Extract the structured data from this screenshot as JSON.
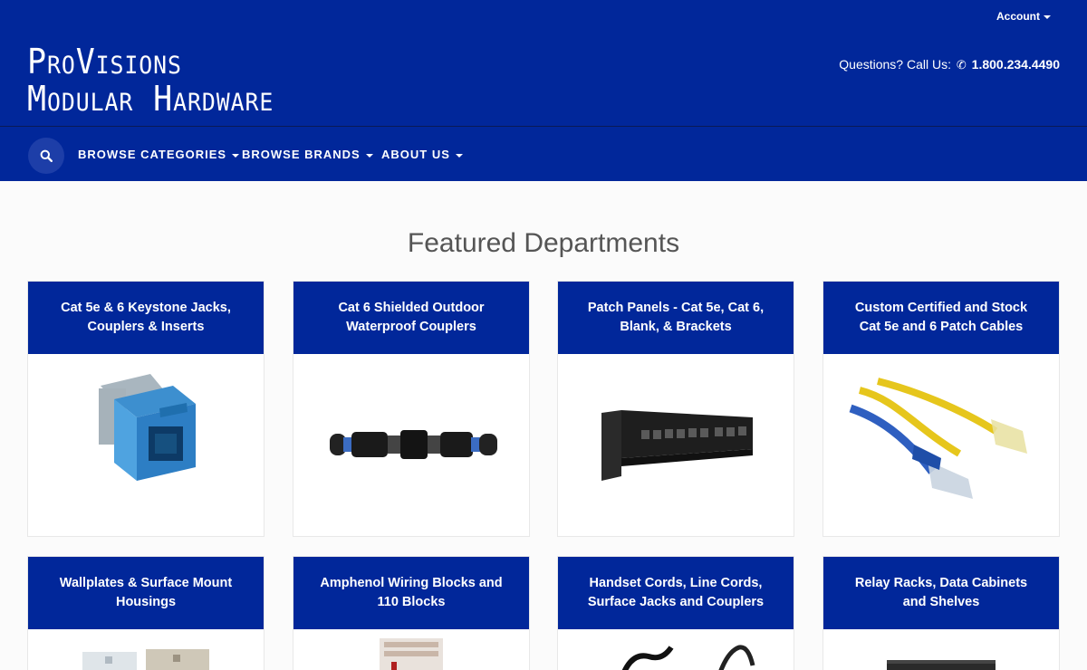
{
  "header": {
    "logo_line1": "ProVisions",
    "logo_line2": "Modular Hardware",
    "account_label": "Account",
    "phone_prefix": "Questions? Call Us:",
    "phone_number": "1.800.234.4490"
  },
  "nav": {
    "items": [
      {
        "label": "BROWSE CATEGORIES"
      },
      {
        "label": "BROWSE BRANDS"
      },
      {
        "label": "ABOUT US"
      }
    ]
  },
  "main": {
    "section_title": "Featured Departments",
    "departments": [
      {
        "title": "Cat 5e & 6 Keystone Jacks, Couplers & Inserts"
      },
      {
        "title": "Cat 6 Shielded Outdoor Waterproof Couplers"
      },
      {
        "title": "Patch Panels - Cat 5e, Cat 6, Blank, & Brackets"
      },
      {
        "title": "Custom Certified and Stock Cat 5e and 6 Patch Cables"
      },
      {
        "title": "Wallplates & Surface Mount Housings"
      },
      {
        "title": "Amphenol Wiring Blocks and 110 Blocks"
      },
      {
        "title": "Handset Cords, Line Cords, Surface Jacks and Couplers"
      },
      {
        "title": "Relay Racks, Data Cabinets and Shelves"
      }
    ]
  },
  "colors": {
    "brand_blue": "#01279a",
    "background": "#fbfbfb"
  },
  "icons": [
    "search-icon",
    "phone-icon",
    "caret-down-icon"
  ]
}
